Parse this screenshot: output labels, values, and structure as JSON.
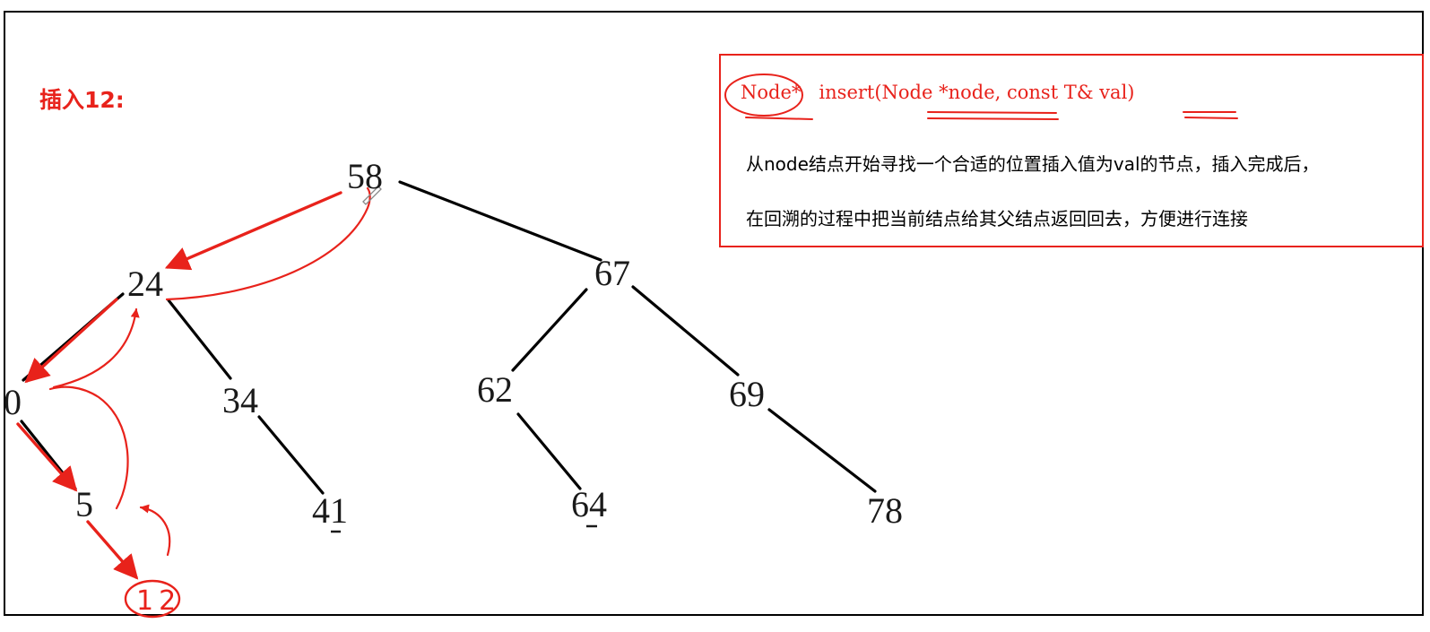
{
  "title": "插入12:",
  "signature": {
    "return_type": "Node*",
    "rest": "insert(Node *node, const T& val)"
  },
  "description": [
    "从node结点开始寻找一个合适的位置插入值为val的节点，插入完成后，",
    "在回溯的过程中把当前结点给其父结点返回回去，方便进行连接"
  ],
  "tree": {
    "nodes": [
      "58",
      "24",
      "67",
      "0",
      "34",
      "62",
      "69",
      "5",
      "41",
      "64",
      "78"
    ],
    "edges": [
      [
        "58",
        "24"
      ],
      [
        "58",
        "67"
      ],
      [
        "24",
        "0"
      ],
      [
        "24",
        "34"
      ],
      [
        "67",
        "62"
      ],
      [
        "67",
        "69"
      ],
      [
        "0",
        "5"
      ],
      [
        "34",
        "41"
      ],
      [
        "62",
        "64"
      ],
      [
        "69",
        "78"
      ],
      [
        "5",
        "12"
      ]
    ],
    "inserted_node": "12",
    "insert_path": [
      "58",
      "24",
      "0",
      "5",
      "12"
    ],
    "backtrack_path": [
      "12",
      "5",
      "0",
      "24",
      "58"
    ]
  },
  "colors": {
    "annotation": "#e8221b",
    "edge": "#000000",
    "text": "#000000"
  }
}
